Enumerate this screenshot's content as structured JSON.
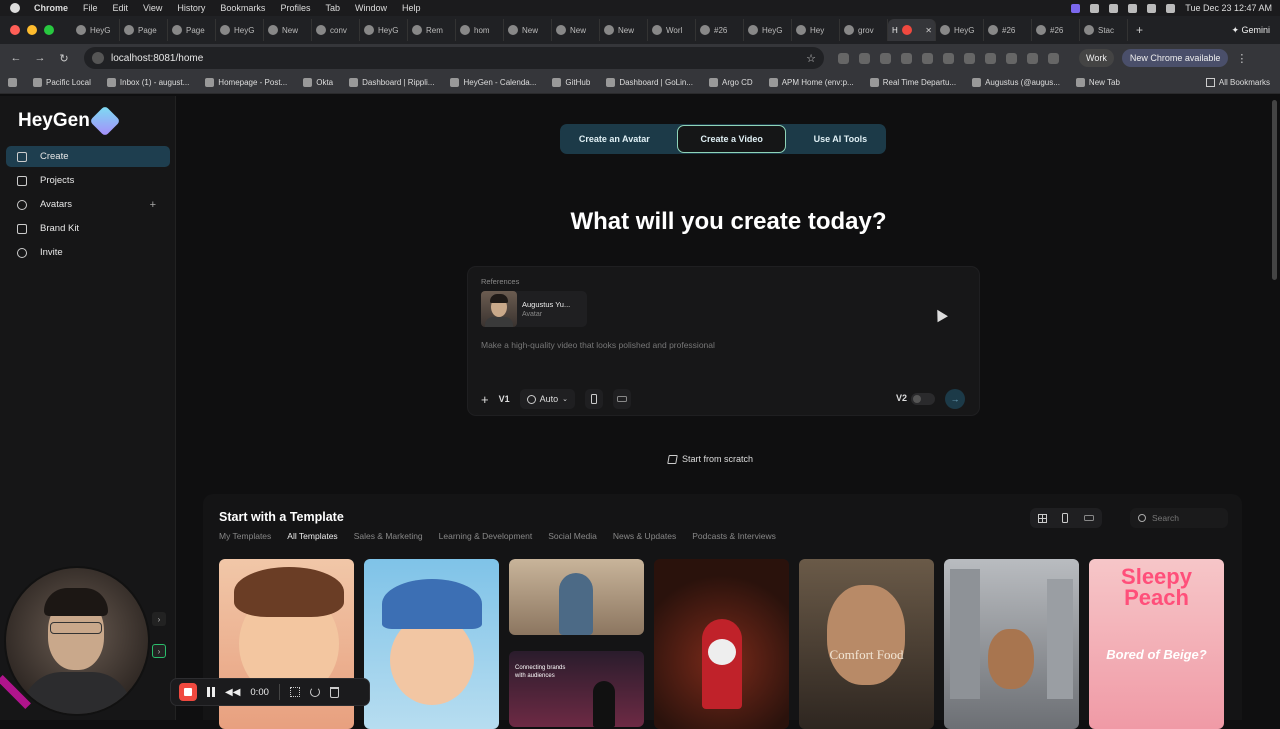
{
  "menubar": {
    "app": "Chrome",
    "items": [
      "File",
      "Edit",
      "View",
      "History",
      "Bookmarks",
      "Profiles",
      "Tab",
      "Window",
      "Help"
    ],
    "clock": "Tue Dec 23 12:47 AM"
  },
  "tabs": [
    {
      "label": "HeyG"
    },
    {
      "label": "Page"
    },
    {
      "label": "Page"
    },
    {
      "label": "HeyG"
    },
    {
      "label": "New"
    },
    {
      "label": "conv"
    },
    {
      "label": "HeyG"
    },
    {
      "label": "Rem"
    },
    {
      "label": "hom"
    },
    {
      "label": "New"
    },
    {
      "label": "New"
    },
    {
      "label": "New"
    },
    {
      "label": "Worl"
    },
    {
      "label": "#26"
    },
    {
      "label": "HeyG"
    },
    {
      "label": "Hey"
    },
    {
      "label": "grov"
    },
    {
      "label": "H",
      "active": true
    },
    {
      "label": "HeyG"
    },
    {
      "label": "#26"
    },
    {
      "label": "#26"
    },
    {
      "label": "Stac"
    }
  ],
  "gemini": "Gemini",
  "toolbar": {
    "url": "localhost:8081/home",
    "work": "Work",
    "update": "New Chrome available"
  },
  "bookmarks": [
    "Pacific Local",
    "Inbox (1) - august...",
    "Homepage - Post...",
    "Okta",
    "Dashboard | Rippli...",
    "HeyGen - Calenda...",
    "GitHub",
    "Dashboard | GoLin...",
    "Argo CD",
    "APM Home (env:p...",
    "Real Time Departu...",
    "Augustus (@augus...",
    "New Tab"
  ],
  "all_bookmarks": "All Bookmarks",
  "sidebar": {
    "brand": "HeyGen",
    "items": [
      {
        "label": "Create",
        "active": true
      },
      {
        "label": "Projects"
      },
      {
        "label": "Avatars",
        "plus": "+"
      },
      {
        "label": "Brand Kit"
      },
      {
        "label": "Invite"
      }
    ]
  },
  "modes": [
    "Create an Avatar",
    "Create a Video",
    "Use AI Tools"
  ],
  "headline": "What will you create today?",
  "composer": {
    "references_label": "References",
    "ref_name": "Augustus Yu...",
    "ref_type": "Avatar",
    "placeholder": "Make a high-quality video that looks polished and professional",
    "add": "+",
    "v1": "V1",
    "auto": "Auto",
    "v2": "V2"
  },
  "scratch": "Start from scratch",
  "templates": {
    "title": "Start with a Template",
    "tabs": [
      "My Templates",
      "All Templates",
      "Sales & Marketing",
      "Learning & Development",
      "Social Media",
      "News & Updates",
      "Podcasts & Interviews"
    ],
    "active_tab": "All Templates",
    "search_placeholder": "Search",
    "card_text": {
      "connecting": "Connecting brands with audiences",
      "comfort": "Comfort Food",
      "sleepy": "Sleepy Peach",
      "bored": "Bored of Beige?"
    }
  },
  "recorder": {
    "time": "0:00"
  }
}
